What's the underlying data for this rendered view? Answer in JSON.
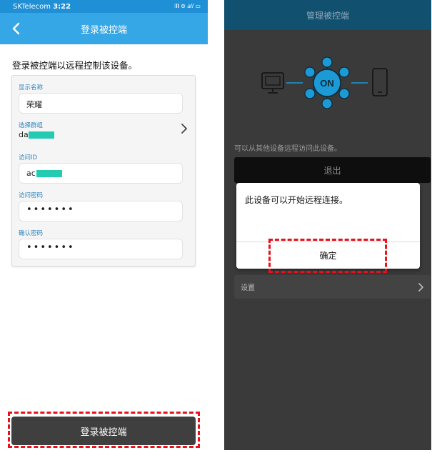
{
  "left": {
    "status": {
      "carrier": "SKTelecom",
      "time": "3:22",
      "icons": "⁝𝐥𝐥 ⊜ 𝑎𝑙𝑙 ▭"
    },
    "header": {
      "title": "登录被控端"
    },
    "intro": "登录被控端以远程控制该设备。",
    "form": {
      "display_name": {
        "label": "显示名称",
        "value": "荣耀"
      },
      "group": {
        "label": "选择群组",
        "value": "da"
      },
      "access_id": {
        "label": "访问ID",
        "value": "ac"
      },
      "password": {
        "label": "访问密码",
        "value": "•••••••"
      },
      "confirm": {
        "label": "确认密码",
        "value": "•••••••"
      }
    },
    "login_button": "登录被控端"
  },
  "right": {
    "header": {
      "title": "管理被控端"
    },
    "diagram": {
      "on_label": "ON"
    },
    "hint": "可以从其他设备远程访问此设备。",
    "exit_button": "退出",
    "dialog": {
      "message": "此设备可以开始远程连接。",
      "ok": "确定"
    },
    "settings_label": "设置"
  },
  "colors": {
    "primary_bar": "#35a6e6",
    "status_bar": "#1f8fd6",
    "dim_header": "#12506f",
    "on_node": "#1b9ad6",
    "highlight": "#e8101a",
    "masked_text": "#22cbb2"
  }
}
